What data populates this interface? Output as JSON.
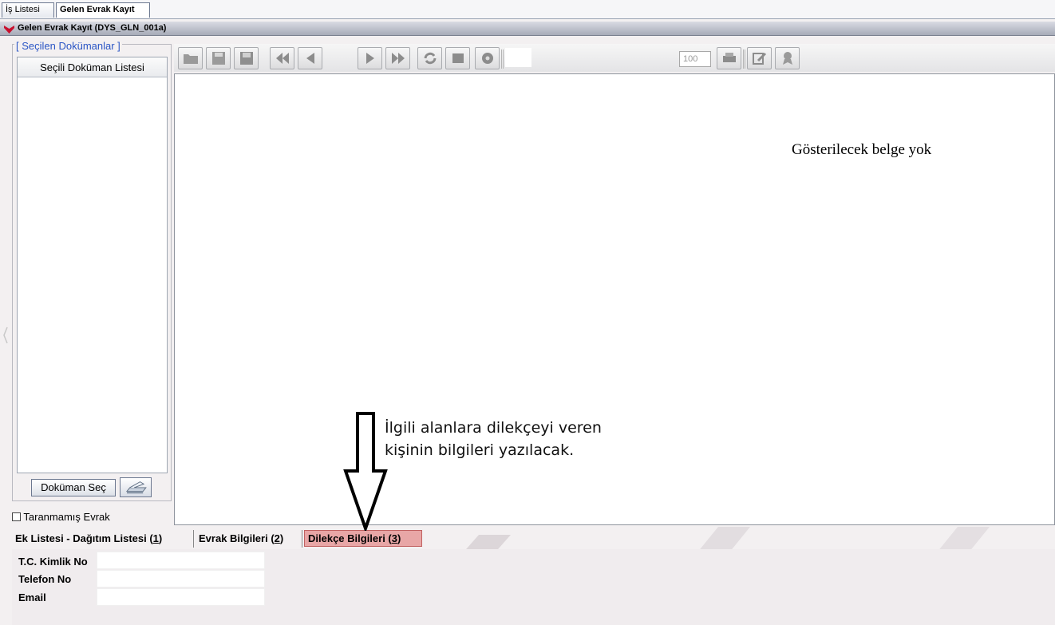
{
  "top_tabs": [
    {
      "label": "İş Listesi"
    },
    {
      "label": "Gelen Evrak Kayıt"
    }
  ],
  "titlebar": {
    "title": "Gelen Evrak Kayıt (DYS_GLN_001a)"
  },
  "left_panel": {
    "legend": "[ Seçilen Dokümanlar ]",
    "list_header": "Seçili Doküman Listesi",
    "select_button": "Doküman Seç",
    "checkbox_label": "Taranmamış Evrak"
  },
  "toolbar": {
    "zoom_value": "100",
    "icons": [
      "open-icon",
      "save-icon",
      "save-all-icon",
      "first-page-icon",
      "prev-page-icon",
      "next-page-icon",
      "last-page-icon",
      "rotate-icon",
      "fit-icon",
      "settings-icon",
      "print-icon",
      "edit-icon",
      "certificate-icon"
    ]
  },
  "viewer": {
    "empty_message": "Gösterilecek belge yok"
  },
  "bottom_tabs": [
    {
      "label": "Ek Listesi - Dağıtım Listesi (",
      "key": "1",
      "suffix": ")"
    },
    {
      "label": "Evrak Bilgileri (",
      "key": "2",
      "suffix": ")"
    },
    {
      "label": "Dilekçe Bilgileri (",
      "key": "3",
      "suffix": ")"
    }
  ],
  "form": {
    "fields": [
      {
        "label": "T.C. Kimlik No",
        "value": ""
      },
      {
        "label": "Telefon No",
        "value": ""
      },
      {
        "label": "Email",
        "value": ""
      }
    ]
  },
  "annotation": {
    "line1": "İlgili alanlara dilekçeyi veren",
    "line2": "kişinin bilgileri yazılacak."
  },
  "colors": {
    "active_tab_bg": "#e8a6a6",
    "legend_text": "#2b56c5"
  }
}
